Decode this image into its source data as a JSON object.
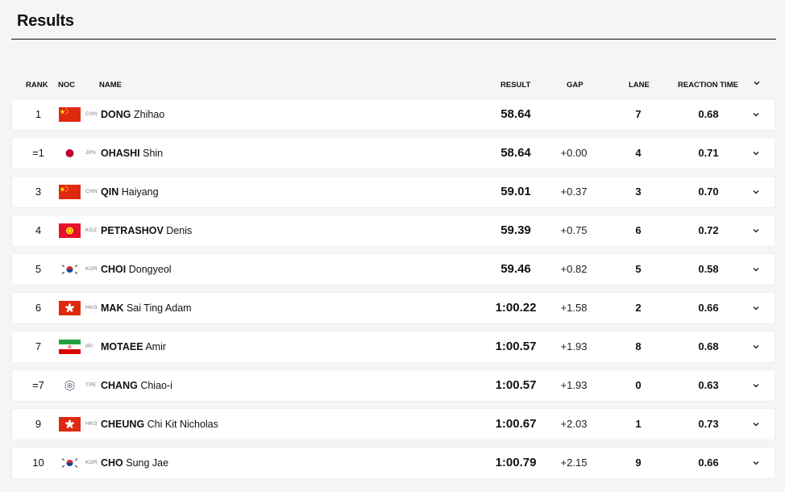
{
  "header": {
    "title": "Results"
  },
  "columns": {
    "rank": "RANK",
    "noc": "NOC",
    "name": "NAME",
    "result": "RESULT",
    "gap": "GAP",
    "lane": "LANE",
    "reaction_time": "REACTION TIME"
  },
  "rows": [
    {
      "rank": "1",
      "flag": "china-flag-icon",
      "noc": "CHN",
      "last": "DONG",
      "first": "Zhihao",
      "result": "58.64",
      "gap": "",
      "lane": "7",
      "reaction": "0.68"
    },
    {
      "rank": "=1",
      "flag": "japan-flag-icon",
      "noc": "JPN",
      "last": "OHASHI",
      "first": "Shin",
      "result": "58.64",
      "gap": "+0.00",
      "lane": "4",
      "reaction": "0.71"
    },
    {
      "rank": "3",
      "flag": "china-flag-icon",
      "noc": "CHN",
      "last": "QIN",
      "first": "Haiyang",
      "result": "59.01",
      "gap": "+0.37",
      "lane": "3",
      "reaction": "0.70"
    },
    {
      "rank": "4",
      "flag": "kyrgyzstan-flag-icon",
      "noc": "KGZ",
      "last": "PETRASHOV",
      "first": "Denis",
      "result": "59.39",
      "gap": "+0.75",
      "lane": "6",
      "reaction": "0.72"
    },
    {
      "rank": "5",
      "flag": "korea-flag-icon",
      "noc": "KOR",
      "last": "CHOI",
      "first": "Dongyeol",
      "result": "59.46",
      "gap": "+0.82",
      "lane": "5",
      "reaction": "0.58"
    },
    {
      "rank": "6",
      "flag": "hong-kong-flag-icon",
      "noc": "HKG",
      "last": "MAK",
      "first": "Sai Ting Adam",
      "result": "1:00.22",
      "gap": "+1.58",
      "lane": "2",
      "reaction": "0.66"
    },
    {
      "rank": "7",
      "flag": "iran-flag-icon",
      "noc": "IRI",
      "last": "MOTAEE",
      "first": "Amir",
      "result": "1:00.57",
      "gap": "+1.93",
      "lane": "8",
      "reaction": "0.68"
    },
    {
      "rank": "=7",
      "flag": "chinese-taipei-flag-icon",
      "noc": "TPE",
      "last": "CHANG",
      "first": "Chiao-i",
      "result": "1:00.57",
      "gap": "+1.93",
      "lane": "0",
      "reaction": "0.63"
    },
    {
      "rank": "9",
      "flag": "hong-kong-flag-icon",
      "noc": "HKG",
      "last": "CHEUNG",
      "first": "Chi Kit Nicholas",
      "result": "1:00.67",
      "gap": "+2.03",
      "lane": "1",
      "reaction": "0.73"
    },
    {
      "rank": "10",
      "flag": "korea-flag-icon",
      "noc": "KOR",
      "last": "CHO",
      "first": "Sung Jae",
      "result": "1:00.79",
      "gap": "+2.15",
      "lane": "9",
      "reaction": "0.66"
    }
  ],
  "colors": {
    "china": "#de2910",
    "japan": "#bc002d",
    "kyrgyzstan": "#e8112d",
    "hong_kong": "#de2910",
    "iran_green": "#239f40",
    "iran_red": "#da0000"
  }
}
